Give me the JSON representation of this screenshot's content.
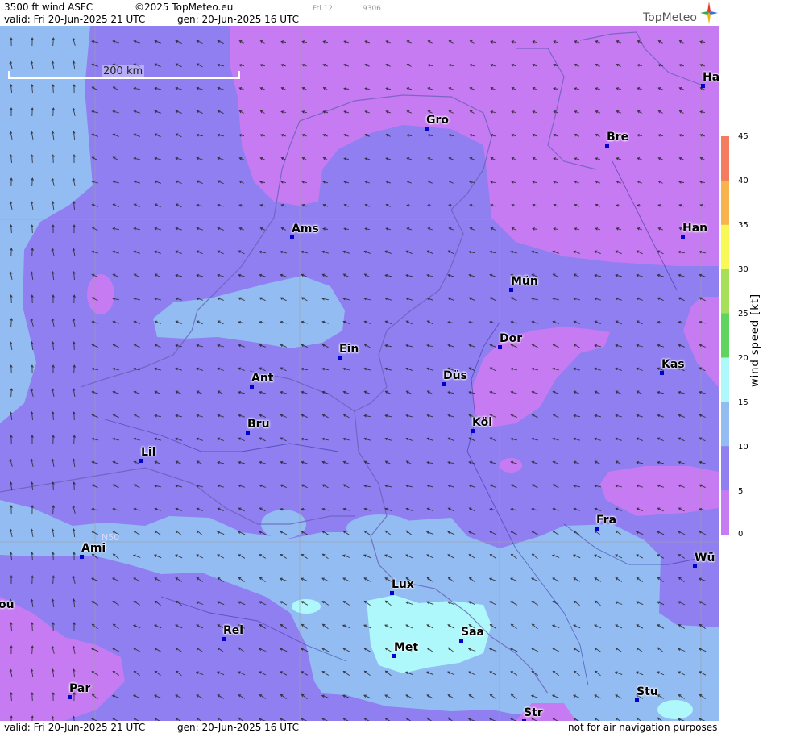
{
  "header": {
    "product": "3500 ft wind ASFC",
    "copyright": "©2025 TopMeteo.eu",
    "day": "Fri 12",
    "code": "9306",
    "valid": "valid:  Fri  20-Jun-2025  21 UTC",
    "gen": "gen: 20-Jun-2025 16 UTC"
  },
  "footer": {
    "valid": "valid:  Fri  20-Jun-2025  21 UTC",
    "gen": "gen: 20-Jun-2025 16 UTC",
    "disclaimer": "not for air navigation purposes"
  },
  "logo": {
    "name": "TopMeteo"
  },
  "scale_bar": {
    "label": "200 km"
  },
  "gridline_label": "N50",
  "cities": [
    {
      "label": "Gro"
    },
    {
      "label": "Bre"
    },
    {
      "label": "Ha"
    },
    {
      "label": "Ams"
    },
    {
      "label": "Han"
    },
    {
      "label": "Mün"
    },
    {
      "label": "Ein"
    },
    {
      "label": "Dor"
    },
    {
      "label": "Ant"
    },
    {
      "label": "Düs"
    },
    {
      "label": "Kas"
    },
    {
      "label": "Bru"
    },
    {
      "label": "Köl"
    },
    {
      "label": "Lil"
    },
    {
      "label": "Fra"
    },
    {
      "label": "Ami"
    },
    {
      "label": "Wü"
    },
    {
      "label": "Lux"
    },
    {
      "label": "ou"
    },
    {
      "label": "Rei"
    },
    {
      "label": "Saa"
    },
    {
      "label": "Met"
    },
    {
      "label": "Par"
    },
    {
      "label": "Stu"
    },
    {
      "label": "Str"
    }
  ],
  "legend": {
    "title": "wind speed [kt]",
    "ticks": [
      "45",
      "40",
      "35",
      "30",
      "25",
      "20",
      "15",
      "10",
      "5",
      "0"
    ],
    "colors": {
      "0-5": "#c67bf2",
      "5-10": "#8f7ff0",
      "10-15": "#93bcf2",
      "15-20": "#aef8fb",
      "20-25": "#5fd45f",
      "25-30": "#a6e05a",
      "30-35": "#f8f857",
      "35-40": "#f8b34f",
      "40-45": "#f47b5f"
    }
  }
}
